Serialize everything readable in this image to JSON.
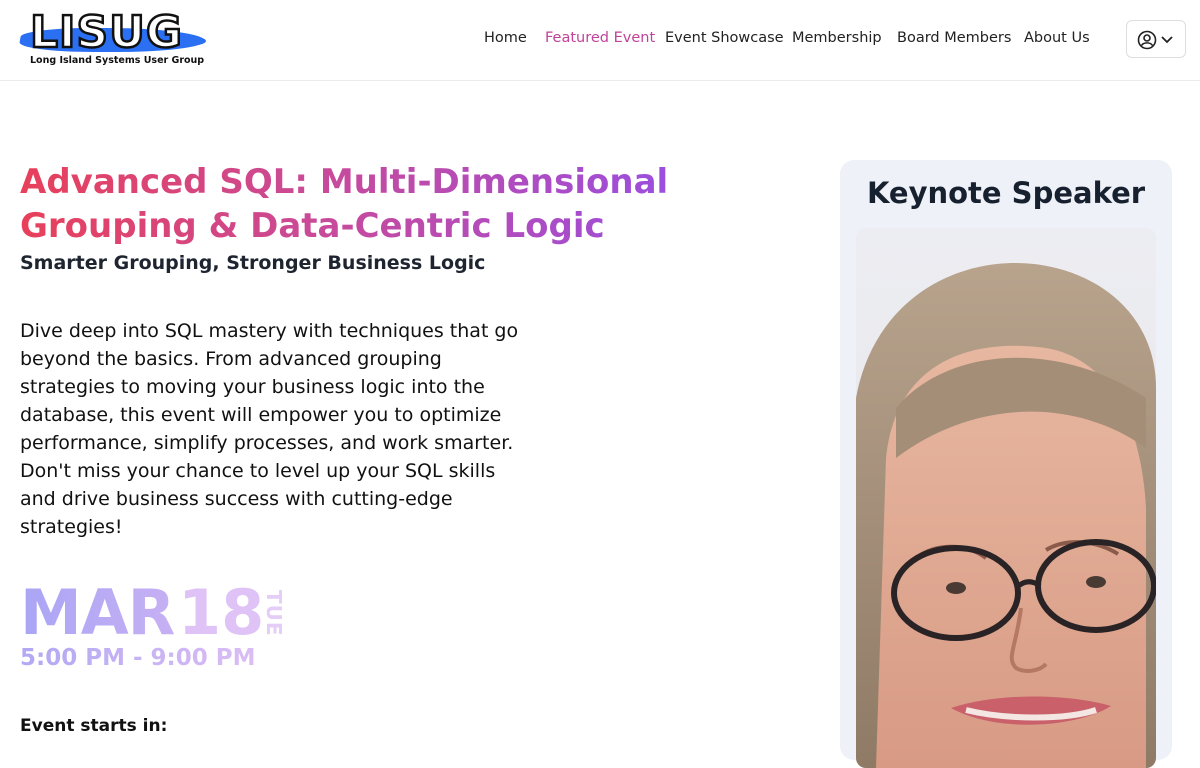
{
  "header": {
    "logo_text": "LISUG",
    "logo_subtitle": "Long Island Systems User Group",
    "nav": [
      {
        "label": "Home",
        "active": false
      },
      {
        "label": "Featured Event",
        "active": true
      },
      {
        "label": "Event Showcase",
        "active": false
      },
      {
        "label": "Membership",
        "active": false
      },
      {
        "label": "Board Members",
        "active": false
      },
      {
        "label": "About Us",
        "active": false
      }
    ],
    "user_menu_icon": "user-circle-icon",
    "dropdown_icon": "chevron-down-icon"
  },
  "event": {
    "title": "Advanced SQL: Multi-Dimensional Grouping & Data-Centric Logic",
    "subtitle": "Smarter Grouping, Stronger Business Logic",
    "description": "Dive deep into SQL mastery with techniques that go beyond the basics. From advanced grouping strategies to moving your business logic into the database, this event will empower you to optimize performance, simplify processes, and work smarter. Don't miss your chance to level up your SQL skills and drive business success with cutting-edge strategies!",
    "month": "MAR",
    "day": "18",
    "weekday": "TUE",
    "time": "5:00 PM - 9:00 PM",
    "countdown_label": "Event starts in:"
  },
  "speaker": {
    "heading": "Keynote Speaker"
  },
  "colors": {
    "accent_active_nav": "#c1439a",
    "title_gradient_start": "#e8405a",
    "title_gradient_end": "#9a4ee0",
    "logo_blue": "#2b6ff2",
    "card_bg": "#eef1f7"
  }
}
